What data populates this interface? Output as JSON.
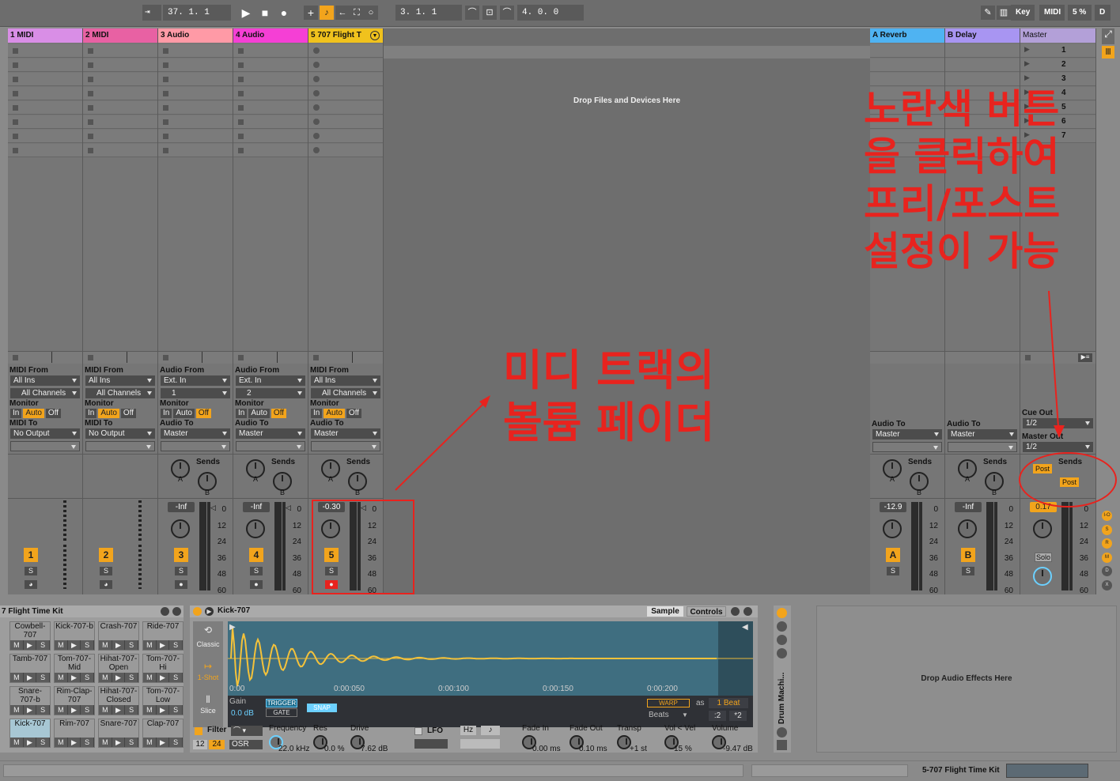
{
  "transport": {
    "tempo_icon": "tap-tempo-icon",
    "position": "37.  1.  1",
    "loop_start": "3.  1.  1",
    "loop_length": "4.  0.  0",
    "key": "Key",
    "midi": "MIDI",
    "cpu": "5 %",
    "d": "D"
  },
  "tracks": [
    {
      "name": "1 MIDI",
      "color": "#d98ee6",
      "type": "midi",
      "from_label": "MIDI From",
      "from": "All Ins",
      "channel": "All Channels",
      "to_label": "MIDI To",
      "to": "No Output",
      "monitor_active": "Auto",
      "number": "1"
    },
    {
      "name": "2 MIDI",
      "color": "#e861a3",
      "type": "midi",
      "from_label": "MIDI From",
      "from": "All Ins",
      "channel": "All Channels",
      "to_label": "MIDI To",
      "to": "No Output",
      "monitor_active": "Auto",
      "number": "2"
    },
    {
      "name": "3 Audio",
      "color": "#ff9aa6",
      "type": "audio",
      "from_label": "Audio From",
      "from": "Ext. In",
      "channel": "1",
      "to_label": "Audio To",
      "to": "Master",
      "monitor_active": "Off",
      "number": "3",
      "volume": "-Inf"
    },
    {
      "name": "4 Audio",
      "color": "#f53fd5",
      "type": "audio",
      "from_label": "Audio From",
      "from": "Ext. In",
      "channel": "2",
      "to_label": "Audio To",
      "to": "Master",
      "monitor_active": "Off",
      "number": "4",
      "volume": "-Inf"
    },
    {
      "name": "5 707 Flight T",
      "color": "#f0c21d",
      "type": "midi",
      "from_label": "MIDI From",
      "from": "All Ins",
      "channel": "All Channels",
      "to_label": "Audio To",
      "to": "Master",
      "monitor_active": "Auto",
      "number": "5",
      "volume": "-0.30"
    }
  ],
  "monitor": {
    "label": "Monitor",
    "in": "In",
    "auto": "Auto",
    "off": "Off"
  },
  "sends_label": "Sends",
  "drop_files": "Drop Files and Devices Here",
  "returns": [
    {
      "name": "A Reverb",
      "color": "#4fb3f2",
      "to_label": "Audio To",
      "to": "Master",
      "number": "A",
      "volume": "-12.9"
    },
    {
      "name": "B Delay",
      "color": "#a895f2",
      "to_label": "Audio To",
      "to": "Master",
      "number": "B",
      "volume": "-Inf"
    }
  ],
  "master": {
    "name": "Master",
    "color": "#b3a0d8",
    "scenes": [
      "1",
      "2",
      "3",
      "4",
      "5",
      "6",
      "7"
    ],
    "cue_out_label": "Cue Out",
    "cue_out": "1/2",
    "master_out_label": "Master Out",
    "master_out": "1/2",
    "post1": "Post",
    "post2": "Post",
    "volume": "0.17",
    "solo": "Solo"
  },
  "meter_scale": [
    "0",
    "12",
    "24",
    "36",
    "48",
    "60"
  ],
  "knob_labels": {
    "a": "A",
    "b": "B"
  },
  "annotations": {
    "top": [
      "노란색 버튼",
      "을 클릭하여",
      "프리/포스트",
      "설정이 가능"
    ],
    "middle": [
      "미디 트랙의",
      "볼륨 페이더"
    ]
  },
  "drumrack": {
    "title": "7 Flight Time Kit",
    "pads": [
      [
        "Cowbell-707",
        "Kick-707-b",
        "Crash-707",
        "Ride-707"
      ],
      [
        "Tamb-707",
        "Tom-707-Mid",
        "Hihat-707-Open",
        "Tom-707-Hi"
      ],
      [
        "Snare-707-b",
        "Rim-Clap-707",
        "Hihat-707-Closed",
        "Tom-707-Low"
      ],
      [
        "Kick-707",
        "Rim-707",
        "Snare-707",
        "Clap-707"
      ]
    ]
  },
  "simpler": {
    "title": "Kick-707",
    "tab_sample": "Sample",
    "tab_controls": "Controls",
    "modes": [
      "Classic",
      "1-Shot",
      "Slice"
    ],
    "gain_label": "Gain",
    "gain": "0.0 dB",
    "trigger": "TRIGGER",
    "gate": "GATE",
    "snap": "SNAP",
    "warp": "WARP",
    "as": "as",
    "beat": "1 Beat",
    "beats": "Beats",
    "div": ":2",
    "mul": "*2",
    "timeline": [
      "0:00",
      "0:00:050",
      "0:00:100",
      "0:00:150",
      "0:00:200"
    ],
    "filter": "Filter",
    "n12": "12",
    "n24": "24",
    "osr": "OSR",
    "frequency_label": "Frequency",
    "frequency": "22.0 kHz",
    "res_label": "Res",
    "res": "0.0 %",
    "drive_label": "Drive",
    "drive": "7.62 dB",
    "lfo": "LFO",
    "hz": "Hz",
    "fade_in_label": "Fade In",
    "fade_in": "0.00 ms",
    "fade_out_label": "Fade Out",
    "fade_out": "0.10 ms",
    "transp_label": "Transp",
    "transp": "+1 st",
    "vol_vel_label": "Vol < Vel",
    "vol_vel": "15 %",
    "volume_label": "Volume",
    "volume": "-9.47 dB"
  },
  "drum_machine_label": "Drum Machi...",
  "drop_effects": "Drop Audio Effects Here",
  "status": "5-707 Flight Time Kit",
  "mix_toggles": [
    "I-O",
    "S",
    "R",
    "M",
    "D",
    "X"
  ]
}
